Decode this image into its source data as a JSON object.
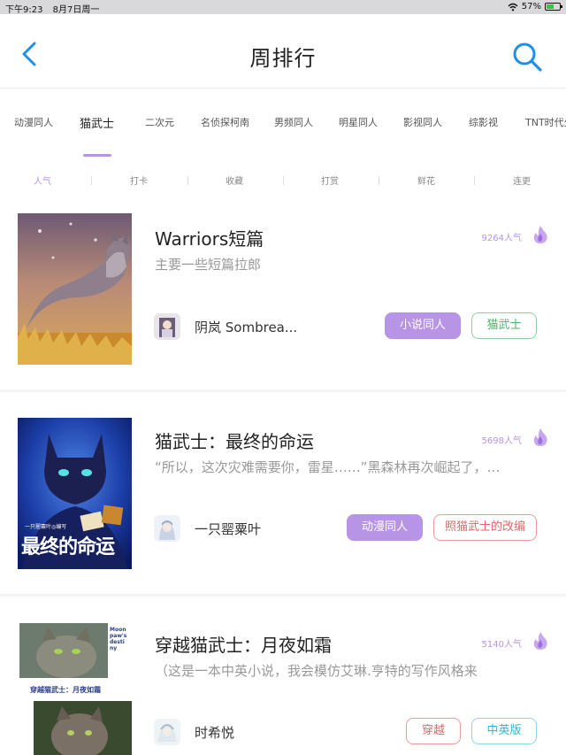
{
  "status_bar": {
    "time": "下午9:23",
    "date": "8月7日周一",
    "battery": "57%",
    "battery_level": 0.57
  },
  "header": {
    "title": "周排行"
  },
  "category_tabs": [
    {
      "label": "动漫同人",
      "active": false
    },
    {
      "label": "猫武士",
      "active": true
    },
    {
      "label": "二次元",
      "active": false
    },
    {
      "label": "名侦探柯南",
      "active": false
    },
    {
      "label": "男频同人",
      "active": false
    },
    {
      "label": "明星同人",
      "active": false
    },
    {
      "label": "影视同人",
      "active": false
    },
    {
      "label": "综影视",
      "active": false
    },
    {
      "label": "TNT时代少",
      "active": false
    }
  ],
  "sort_tabs": [
    {
      "label": "人气",
      "active": true
    },
    {
      "label": "打卡",
      "active": false
    },
    {
      "label": "收藏",
      "active": false
    },
    {
      "label": "打赏",
      "active": false
    },
    {
      "label": "鲜花",
      "active": false
    },
    {
      "label": "连更",
      "active": false
    }
  ],
  "books": [
    {
      "title": "Warriors短篇",
      "description": "主要一些短篇拉郎",
      "popularity": "9264人气",
      "author": "阴岚 Sombrea...",
      "tags": [
        {
          "label": "小说同人",
          "style": "filled"
        },
        {
          "label": "猫武士",
          "style": "green"
        }
      ]
    },
    {
      "title": "猫武士：最终的命运",
      "description": "“所以，这次灾难需要你，雷星……”黑森林再次崛起了，…",
      "popularity": "5698人气",
      "author": "一只罂粟叶",
      "cover_text": "最终的命运",
      "cover_subtext": "一只罂粟叶◎编写",
      "tags": [
        {
          "label": "动漫同人",
          "style": "filled"
        },
        {
          "label": "照猫武士的改编",
          "style": "red"
        }
      ]
    },
    {
      "title": "穿越猫武士：月夜如霜",
      "description": "（这是一本中英小说，我会模仿艾琳.亨特的写作风格来",
      "popularity": "5140人气",
      "author": "时希悦",
      "cover_text": "穿越猫武士：月夜如霜",
      "cover_side_text": "Moonpaw's destiny",
      "tags": [
        {
          "label": "穿越",
          "style": "red"
        },
        {
          "label": "中英版",
          "style": "cyan"
        }
      ]
    }
  ],
  "colors": {
    "accent": "#b794e6",
    "back_icon": "#1e90e8",
    "flame": "#b794e6"
  }
}
